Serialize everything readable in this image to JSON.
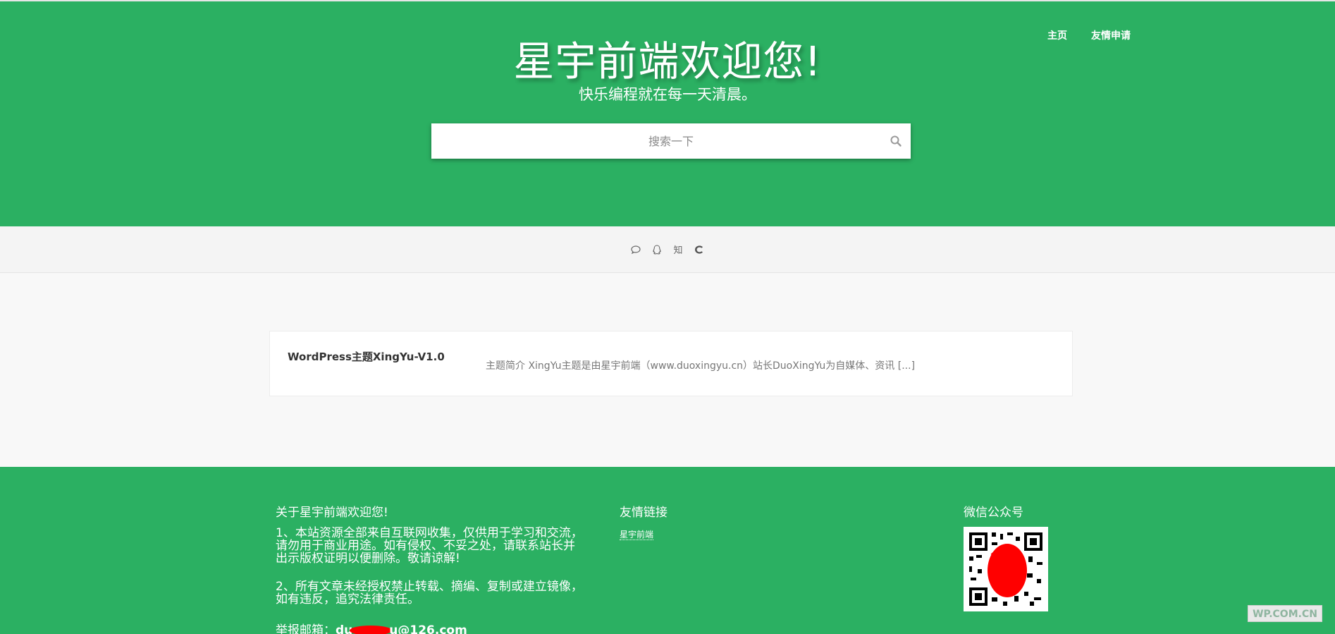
{
  "header": {
    "title": "星宇前端欢迎您!",
    "subtitle": "快乐编程就在每一天清晨。",
    "nav": [
      {
        "label": "主页"
      },
      {
        "label": "友情申请"
      }
    ],
    "search": {
      "placeholder": "搜索一下",
      "icon": "search-icon"
    }
  },
  "social": {
    "icons": [
      {
        "name": "chat-bubble-icon"
      },
      {
        "name": "qq-icon"
      },
      {
        "name": "zhihu-icon",
        "glyph": "知"
      },
      {
        "name": "csdn-icon"
      }
    ]
  },
  "posts": [
    {
      "title": "WordPress主题XingYu-V1.0",
      "excerpt": "主题简介 XingYu主题是由星宇前端（www.duoxingyu.cn）站长DuoXingYu为自媒体、资讯 [...]"
    }
  ],
  "footer": {
    "about": {
      "title": "关于星宇前端欢迎您!",
      "p1": "1、本站资源全部来自互联网收集，仅供用于学习和交流，请勿用于商业用途。如有侵权、不妥之处，请联系站长并出示版权证明以便删除。敬请谅解!",
      "p2": "2、所有文章未经授权禁止转载、摘编、复制或建立镜像，如有违反，追究法律责任。",
      "email_label": "举报邮箱：",
      "email_prefix": "du",
      "email_suffix": "u@126.com"
    },
    "links": {
      "title": "友情链接",
      "items": [
        {
          "label": "星宇前端"
        }
      ]
    },
    "wechat": {
      "title": "微信公众号"
    },
    "watermark": "WP.COM.CN"
  },
  "colors": {
    "brand_green": "#2bb062",
    "redaction": "#ff0000"
  }
}
